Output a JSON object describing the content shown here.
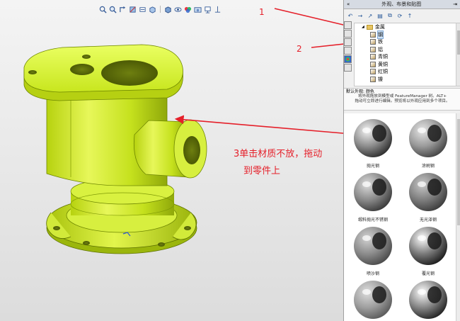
{
  "taskpane": {
    "title": "外观、布景和贴图",
    "collapse_glyph": "«",
    "pin_glyph": "⇥",
    "toolbar_glyphs": [
      "↶",
      "→",
      "↗",
      "▤",
      "⧉",
      "⟳",
      "↑"
    ],
    "tree": {
      "root": {
        "label": "金属",
        "expander": "◢"
      },
      "items": [
        {
          "label": "钢",
          "selected": true
        },
        {
          "label": "铁"
        },
        {
          "label": "铝"
        },
        {
          "label": "青铜"
        },
        {
          "label": "黄铜"
        },
        {
          "label": "红铜"
        },
        {
          "label": "镍"
        }
      ]
    },
    "description": {
      "header": "默认外观: 颜色",
      "line1": "将外观拖放到模型或 FeatureManager 树。ALT+",
      "line2": "拖动可立即进行编辑。预览将以外观应用到多个项目。"
    },
    "gallery": [
      {
        "label": "抛光钢",
        "style": "polished"
      },
      {
        "label": "涂刷钢",
        "style": "brushed"
      },
      {
        "label": "缎料抛光不锈钢",
        "style": "satin"
      },
      {
        "label": "无光泽钢",
        "style": "matte"
      },
      {
        "label": "喷沙钢",
        "style": "sand"
      },
      {
        "label": "覆光钢",
        "style": "chrome"
      },
      {
        "label": "",
        "style": "cast"
      },
      {
        "label": "",
        "style": "chrome2"
      }
    ]
  },
  "callouts": {
    "one": "1",
    "two": "2",
    "three_line1": "3单击材质不放，拖动",
    "three_line2": "到零件上"
  },
  "hud_icons": [
    "zoom-fit-icon",
    "zoom-area-icon",
    "previous-view-icon",
    "section-view-icon",
    "dynamic-annotation-icon",
    "view-orientation-icon",
    "display-style-icon",
    "hide-show-icon",
    "edit-appearance-icon",
    "apply-scene-icon",
    "view-settings-icon"
  ],
  "colors": {
    "part": "#c8e61e",
    "part_dark": "#6e8a00",
    "annotation": "#e5202a"
  }
}
